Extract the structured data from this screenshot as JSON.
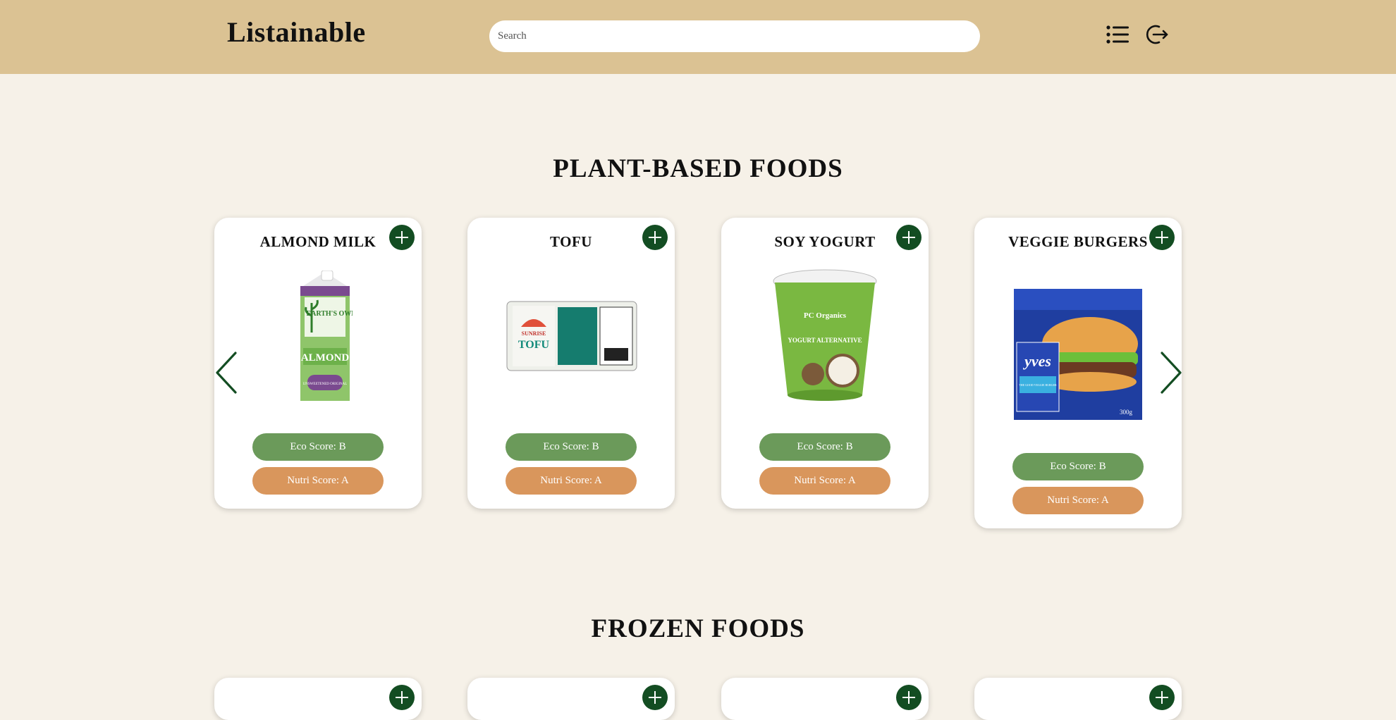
{
  "header": {
    "logo": "Listainable",
    "search_placeholder": "Search",
    "list_icon": "list-icon",
    "logout_icon": "logout-icon"
  },
  "sections": [
    {
      "title": "PLANT-BASED FOODS",
      "products": [
        {
          "name": "ALMOND MILK",
          "eco": "Eco Score: B",
          "nutri": "Nutri Score: A"
        },
        {
          "name": "TOFU",
          "eco": "Eco Score: B",
          "nutri": "Nutri Score: A"
        },
        {
          "name": "SOY YOGURT",
          "eco": "Eco Score: B",
          "nutri": "Nutri Score: A"
        },
        {
          "name": "VEGGIE BURGERS",
          "eco": "Eco Score: B",
          "nutri": "Nutri Score: A"
        }
      ]
    },
    {
      "title": "FROZEN FOODS"
    }
  ],
  "product_images": {
    "almond_milk": {
      "brand": "EARTH'S OWN",
      "label": "ALMOND",
      "sub": "UNSWEETENED ORIGINAL"
    },
    "tofu": {
      "brand": "SUNRISE",
      "label": "TOFU"
    },
    "soy_yogurt": {
      "brand": "PC Organics",
      "label": "YOGURT ALTERNATIVE"
    },
    "veggie_burgers": {
      "brand": "yves",
      "label": "THE GOOD VEGGIE BURGER",
      "weight": "300g"
    }
  },
  "colors": {
    "header": "#dbc293",
    "background": "#f6f1e8",
    "add_button": "#134d22",
    "eco": "#6b9a5a",
    "nutri": "#d9965c"
  }
}
